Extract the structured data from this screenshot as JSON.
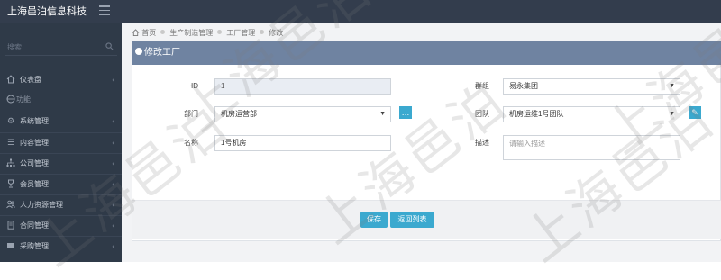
{
  "header": {
    "brand": "上海邑泊信息科技"
  },
  "sidebar": {
    "search_placeholder": "搜索",
    "items": [
      {
        "label": "仪表盘",
        "icon": "home-icon"
      },
      {
        "label": "功能",
        "icon": "globe-icon"
      },
      {
        "label": "系统管理",
        "icon": "gears-icon"
      },
      {
        "label": "内容管理",
        "icon": "list-icon"
      },
      {
        "label": "公司管理",
        "icon": "sitemap-icon"
      },
      {
        "label": "会员管理",
        "icon": "trophy-icon"
      },
      {
        "label": "人力资源管理",
        "icon": "users-icon"
      },
      {
        "label": "合同管理",
        "icon": "contract-icon"
      },
      {
        "label": "采购管理",
        "icon": "cart-icon"
      }
    ]
  },
  "breadcrumb": {
    "items": [
      "首页",
      "生产制造管理",
      "工厂管理",
      "修改"
    ]
  },
  "panel": {
    "title": "修改工厂"
  },
  "form": {
    "id_label": "ID",
    "id_value": "1",
    "group_label": "群组",
    "group_value": "易永集团",
    "dept_label": "部门",
    "dept_value": "机房运营部",
    "team_label": "团队",
    "team_value": "机房运维1号团队",
    "name_label": "名称",
    "name_value": "1号机房",
    "desc_label": "描述",
    "desc_placeholder": "请输入描述"
  },
  "actions": {
    "save": "保存",
    "back": "返回列表"
  },
  "watermark": "上海邑泊",
  "colors": {
    "topbar": "#333d4d",
    "sidebar": "#2f3a48",
    "panel_header": "#6f83a1",
    "accent": "#3ba9cf"
  }
}
